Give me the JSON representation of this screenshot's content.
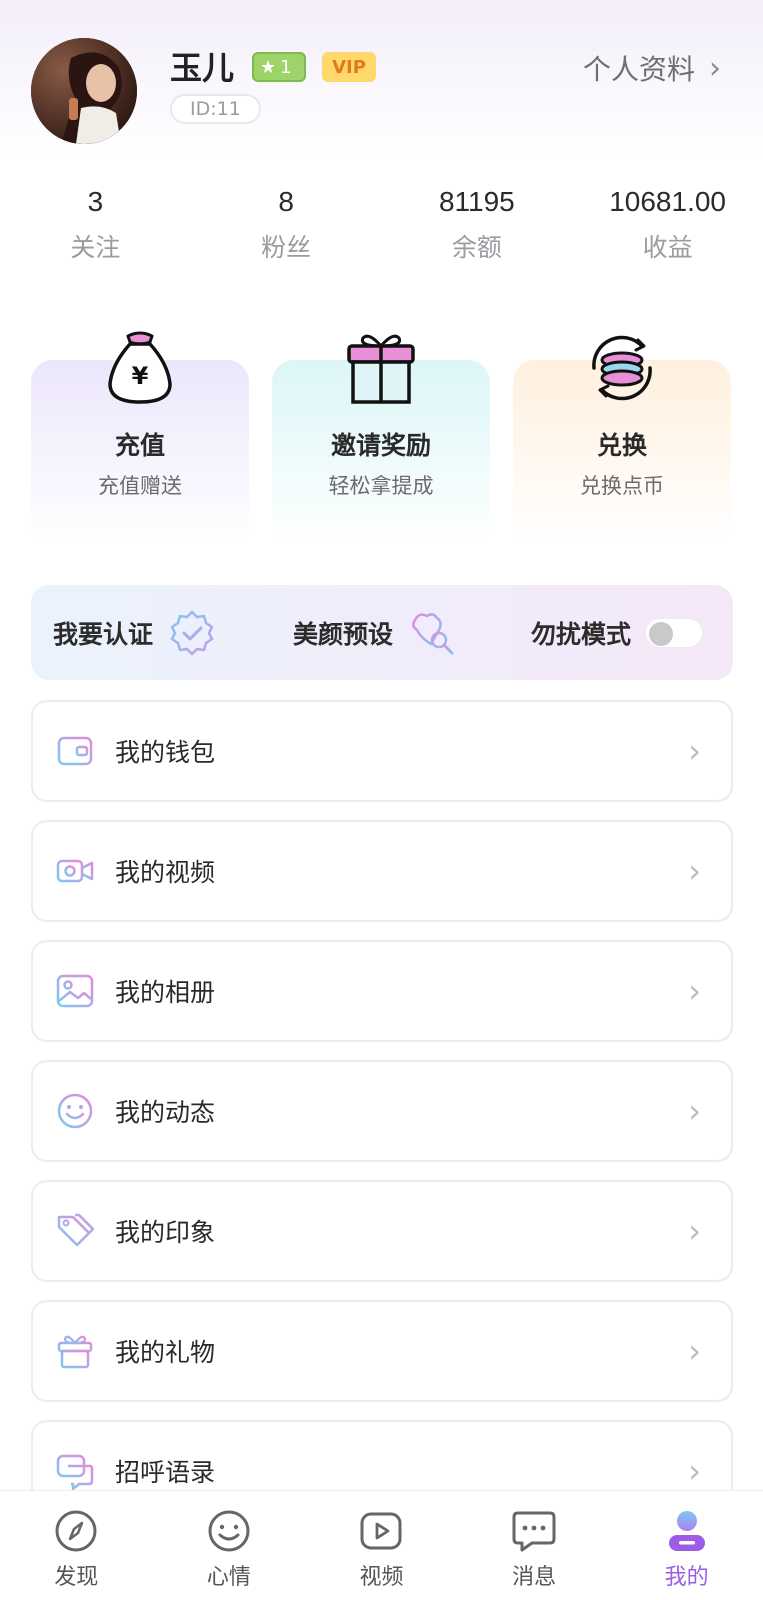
{
  "header": {
    "username": "玉儿",
    "level": "1",
    "vip_label": "VIP",
    "id_text": "ID:11",
    "profile_link_label": "个人资料",
    "profile_link_chevron": "›"
  },
  "stats": [
    {
      "value": "3",
      "label": "关注"
    },
    {
      "value": "8",
      "label": "粉丝"
    },
    {
      "value": "81195",
      "label": "余额"
    },
    {
      "value": "10681.00",
      "label": "收益"
    }
  ],
  "cards": [
    {
      "title": "充值",
      "subtitle": "充值赠送",
      "icon": "money-bag-icon"
    },
    {
      "title": "邀请奖励",
      "subtitle": "轻松拿提成",
      "icon": "gift-box-icon"
    },
    {
      "title": "兑换",
      "subtitle": "兑换点币",
      "icon": "coin-exchange-icon"
    }
  ],
  "quick_bar": {
    "verify_label": "我要认证",
    "beauty_label": "美颜预设",
    "dnd_label": "勿扰模式",
    "dnd_enabled": false
  },
  "menu": [
    {
      "label": "我的钱包",
      "icon": "wallet-icon"
    },
    {
      "label": "我的视频",
      "icon": "video-camera-icon"
    },
    {
      "label": "我的相册",
      "icon": "photo-album-icon"
    },
    {
      "label": "我的动态",
      "icon": "smiley-icon"
    },
    {
      "label": "我的印象",
      "icon": "tags-icon"
    },
    {
      "label": "我的礼物",
      "icon": "gift-icon"
    },
    {
      "label": "招呼语录",
      "icon": "chat-bubbles-icon"
    }
  ],
  "menu_chevron": "›",
  "bottom_nav": [
    {
      "label": "发现",
      "icon": "compass-icon",
      "active": false
    },
    {
      "label": "心情",
      "icon": "smiley-icon",
      "active": false
    },
    {
      "label": "视频",
      "icon": "play-icon",
      "active": false
    },
    {
      "label": "消息",
      "icon": "message-icon",
      "active": false
    },
    {
      "label": "我的",
      "icon": "user-icon",
      "active": true
    }
  ],
  "colors": {
    "accent_purple": "#9b5de5",
    "level_badge": "#9ed36a",
    "vip_badge_bg": "#ffd86b",
    "vip_badge_text": "#e07b19",
    "icon_gradient_start": "#7cc9f0",
    "icon_gradient_end": "#e38bdb"
  }
}
